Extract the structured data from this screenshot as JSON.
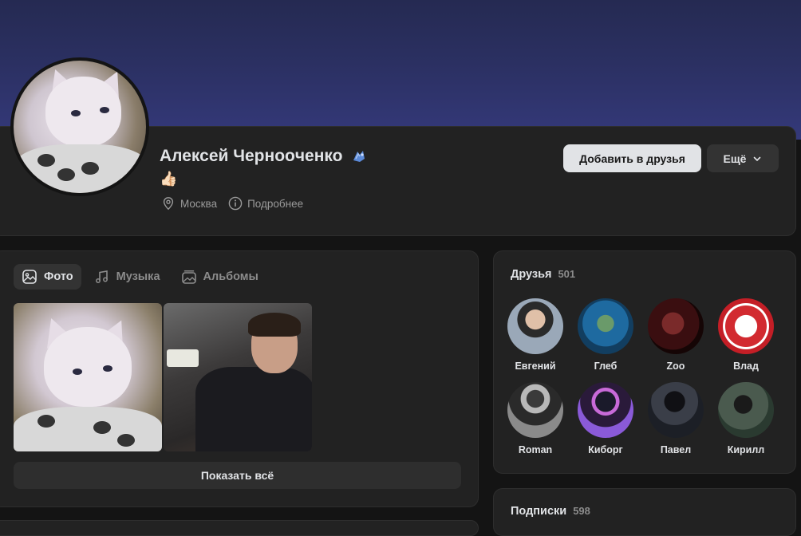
{
  "profile": {
    "name": "Алексей Черноoченко",
    "status_emoji": "👍🏻",
    "city": "Москва",
    "details_label": "Подробнее",
    "add_friend_label": "Добавить в друзья",
    "more_label": "Ещё"
  },
  "media": {
    "tabs": [
      {
        "label": "Фото",
        "icon": "photo-icon",
        "active": true
      },
      {
        "label": "Музыка",
        "icon": "music-icon",
        "active": false
      },
      {
        "label": "Альбомы",
        "icon": "albums-icon",
        "active": false
      }
    ],
    "show_all_label": "Показать всё"
  },
  "friends": {
    "title": "Друзья",
    "count": "501",
    "items": [
      {
        "name": "Евгений",
        "color": "#7a8a9a"
      },
      {
        "name": "Глеб",
        "color": "#2a6a9a"
      },
      {
        "name": "Zoo",
        "color": "#4a1a1a"
      },
      {
        "name": "Влад",
        "color": "#c8202a"
      },
      {
        "name": "Roman",
        "color": "#6a6a6a"
      },
      {
        "name": "Киборг",
        "color": "#6a3aa8"
      },
      {
        "name": "Павел",
        "color": "#2a2e36"
      },
      {
        "name": "Кирилл",
        "color": "#3a4a3e"
      }
    ]
  },
  "subscriptions": {
    "title": "Подписки",
    "count": "598"
  },
  "colors": {
    "background": "#141414",
    "card": "#222222",
    "accent_button": "#e1e3e6",
    "cover": "#2b3062"
  }
}
